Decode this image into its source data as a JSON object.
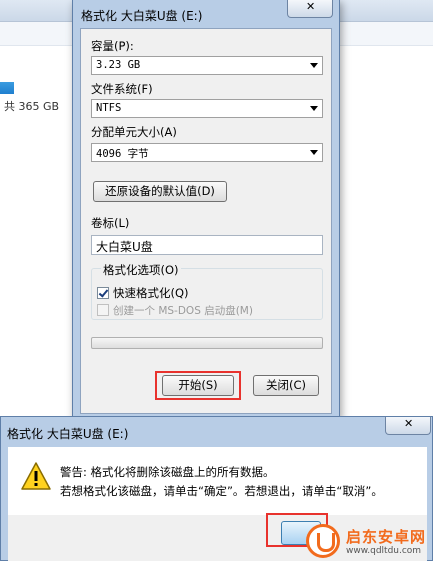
{
  "background": {
    "total_label": "共 365 GB"
  },
  "format_dialog": {
    "title": "格式化 大白菜U盘 (E:)",
    "close_glyph": "✕",
    "capacity": {
      "label": "容量(P):",
      "value": "3.23 GB"
    },
    "filesystem": {
      "label": "文件系统(F)",
      "value": "NTFS"
    },
    "allocation": {
      "label": "分配单元大小(A)",
      "value": "4096 字节"
    },
    "restore_defaults_label": "还原设备的默认值(D)",
    "volume_label": {
      "label": "卷标(L)",
      "value": "大白菜U盘"
    },
    "options": {
      "legend": "格式化选项(O)",
      "quick_format": {
        "label": "快速格式化(Q)",
        "checked": true
      },
      "msdos_boot": {
        "label": "创建一个 MS-DOS 启动盘(M)",
        "checked": false,
        "disabled": true
      }
    },
    "progress_percent": 0,
    "start_label": "开始(S)",
    "close_label": "关闭(C)",
    "highlight_color": "#e8322d"
  },
  "warning_dialog": {
    "title": "格式化 大白菜U盘 (E:)",
    "close_glyph": "✕",
    "line1": "警告: 格式化将删除该磁盘上的所有数据。",
    "line2": "若想格式化该磁盘，请单击“确定”。若想退出，请单击“取消”。",
    "icon": "warning-triangle-icon"
  },
  "watermark": {
    "name": "启东安卓网",
    "url": "www.qdltdu.com",
    "color": "#f26b1d"
  }
}
